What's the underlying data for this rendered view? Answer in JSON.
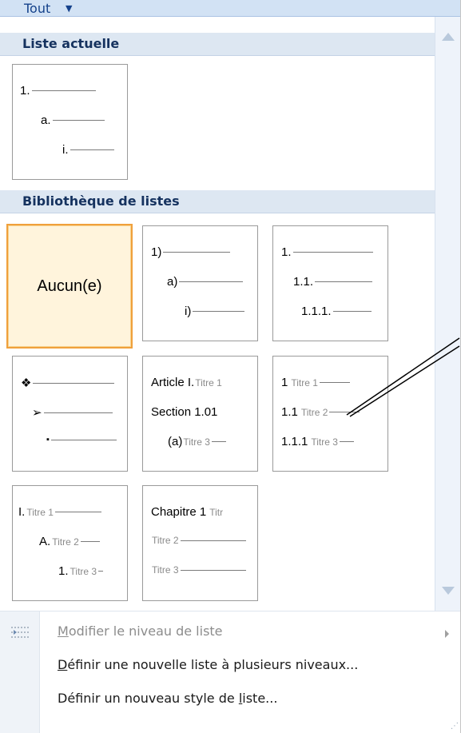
{
  "header": {
    "filter_label": "Tout"
  },
  "current": {
    "title": "Liste actuelle",
    "tiles": [
      {
        "rows": [
          {
            "marker": "1."
          },
          {
            "marker": "a."
          },
          {
            "marker": "i."
          }
        ]
      }
    ]
  },
  "library": {
    "title": "Bibliothèque de listes",
    "none_label": "Aucun(e)",
    "tiles": [
      {
        "rows": [
          {
            "marker": "1)"
          },
          {
            "marker": "a)"
          },
          {
            "marker": "i)"
          }
        ]
      },
      {
        "rows": [
          {
            "marker": "1."
          },
          {
            "marker": "1.1."
          },
          {
            "marker": "1.1.1."
          }
        ]
      },
      {
        "rows": [
          {
            "marker": "❖"
          },
          {
            "marker": "➢"
          },
          {
            "marker": "▪"
          }
        ]
      },
      {
        "rows": [
          {
            "marker": "Article I.",
            "text": "Titre 1"
          },
          {
            "marker": "Section 1.01",
            "text": ""
          },
          {
            "marker": "(a)",
            "text": "Titre 3"
          }
        ]
      },
      {
        "rows": [
          {
            "marker": "1",
            "text": "Titre 1"
          },
          {
            "marker": "1.1",
            "text": "Titre 2"
          },
          {
            "marker": "1.1.1",
            "text": "Titre 3"
          }
        ]
      },
      {
        "rows": [
          {
            "marker": "I.",
            "text": "Titre 1"
          },
          {
            "marker": "A.",
            "text": "Titre 2"
          },
          {
            "marker": "1.",
            "text": "Titre 3"
          }
        ]
      },
      {
        "rows": [
          {
            "marker": "Chapitre 1",
            "text": "Titr"
          },
          {
            "marker": "",
            "text": "Titre 2"
          },
          {
            "marker": "",
            "text": "Titre 3"
          }
        ]
      }
    ]
  },
  "menu": {
    "change_level": {
      "key": "M",
      "rest": "odifier le niveau de liste"
    },
    "define_multilevel": {
      "key": "D",
      "rest": "éfinir une nouvelle liste à plusieurs niveaux..."
    },
    "define_style": {
      "before": "Définir un nouveau style de ",
      "key": "l",
      "after": "iste..."
    }
  },
  "colors": {
    "header_bg": "#dde7f2",
    "selected_border": "#f0a03c",
    "selected_bg": "#fff4dc"
  }
}
